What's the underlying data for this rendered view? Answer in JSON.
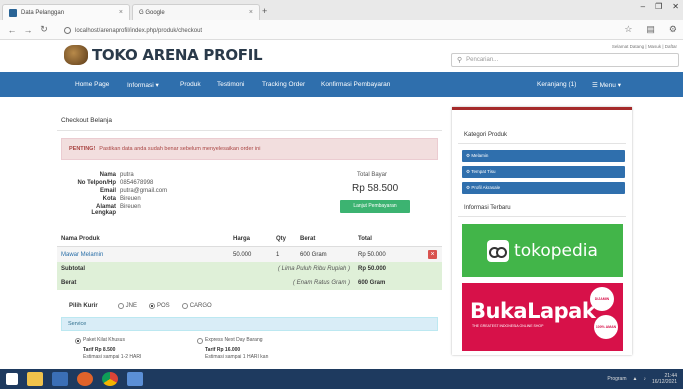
{
  "browser": {
    "tabs": [
      {
        "label": "Data Pelanggan",
        "active": true
      },
      {
        "label": "G Google",
        "active": false
      }
    ],
    "url": "localhost/arenaprofil/index.php/produk/checkout",
    "window_controls": [
      "–",
      "❐",
      "✕"
    ]
  },
  "site": {
    "logo_text": "TOKO ARENA PROFIL",
    "top_links": "Selamat Datang | Masuk | Daftar",
    "search_placeholder": "Pencarian..."
  },
  "nav": {
    "items": [
      "Home Page",
      "Informasi ▾",
      "Produk",
      "Testimoni",
      "Tracking Order",
      "Konfirmasi Pembayaran"
    ],
    "cart": "Keranjang (1)",
    "menu": "☰ Menu ▾"
  },
  "checkout": {
    "title": "Checkout Belanja",
    "alert_strong": "PENTING!",
    "alert_text": "Pastikan data anda sudah benar sebelum menyelesaikan order ini",
    "customer": [
      {
        "label": "Nama",
        "value": "putra"
      },
      {
        "label": "No Telpon/Hp",
        "value": "0854678998"
      },
      {
        "label": "Email",
        "value": "putra@gmail.com"
      },
      {
        "label": "Kota",
        "value": "Bireuen"
      },
      {
        "label": "Alamat Lengkap",
        "value": "Bireuen"
      }
    ],
    "total_label": "Total Bayar",
    "total_value": "Rp 58.500",
    "pay_button": "Lanjut Pembayaran",
    "table": {
      "headers": [
        "Nama Produk",
        "Harga",
        "Qty",
        "Berat",
        "Total"
      ],
      "rows": [
        {
          "product": "Mawar Melamin",
          "price": "50.000",
          "qty": "1",
          "weight": "600 Gram",
          "total": "Rp 50.000"
        }
      ],
      "subtotal_label": "Subtotal",
      "subtotal_words": "( Lima Puluh Ribu Rupiah )",
      "subtotal_value": "Rp 50.000",
      "berat_label": "Berat",
      "berat_words": "( Enam Ratus Gram )",
      "berat_value": "600 Gram"
    },
    "kurir": {
      "label": "Pilih Kurir",
      "options": [
        {
          "label": "JNE",
          "selected": false
        },
        {
          "label": "POS",
          "selected": true
        },
        {
          "label": "CARGO",
          "selected": false
        }
      ]
    },
    "layanan_title": "Service",
    "services": [
      {
        "name": "Paket Kilat Khusus",
        "tarif": "Tarif Rp 8.500",
        "estimasi": "Estimasi sampai 1-2 HARI"
      },
      {
        "name": "Express Next Day Barang",
        "tarif": "Tarif Rp 16.000",
        "estimasi": "Estimasi sampai 1 HARI kan"
      }
    ]
  },
  "sidebar": {
    "kategori_title": "Kategori Produk",
    "kategori": [
      "Melamin",
      "Tempat Tisu",
      "Profil Akrasale"
    ],
    "info_title": "Informasi Terbaru",
    "tokopedia": "tokopedia",
    "bukalapak": "BukaLapak",
    "bukalapak_sub": "THE GREATEST INDONESIA ONLINE SHOP",
    "bukalapak_badge1": "DIJAMIN",
    "bukalapak_badge2": "100% AMAN"
  },
  "taskbar": {
    "time": "21:44",
    "date": "16/12/2021",
    "label": "Program"
  }
}
